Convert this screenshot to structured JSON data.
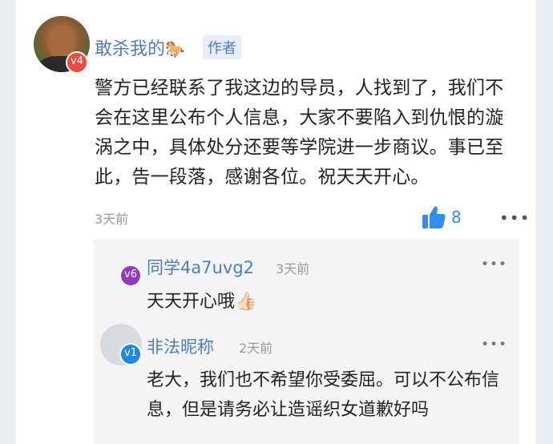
{
  "post": {
    "author": "敢杀我的",
    "author_emoji": "🐎",
    "author_tag": "作者",
    "author_level": "v4",
    "content": "警方已经联系了我这边的导员，人找到了，我们不会在这里公布个人信息，大家不要陷入到仇恨的漩涡之中，具体处分还要等学院进一步商议。事已至此，告一段落，感谢各位。祝天天开心。",
    "time": "3天前",
    "likes": "8",
    "more": "•••"
  },
  "replies": [
    {
      "name": "同学4a7uvg2",
      "level": "v6",
      "time": "3天前",
      "text": "天天开心哦👍🏻",
      "more": "•••"
    },
    {
      "name": "非法昵称",
      "level": "v1",
      "time": "2天前",
      "text": "老大，我们也不希望你受委屈。可以不公布信息，但是请务必让造谣织女道歉好吗",
      "more": "•••"
    }
  ],
  "colors": {
    "name_blue": "#4f7cc4",
    "like_blue": "#2f8ff0",
    "badge_v4": "#e74c3c",
    "badge_v6": "#8e3bbf",
    "badge_v1": "#1e88e5"
  }
}
